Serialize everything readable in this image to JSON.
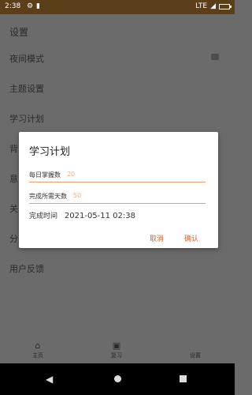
{
  "status_bar": {
    "time": "2:38",
    "network": "LTE",
    "icons": [
      "settings-icon",
      "lock-icon",
      "signal-icon",
      "battery-icon"
    ]
  },
  "app_bar": {
    "title": "设置"
  },
  "settings": {
    "items": [
      {
        "label": "夜间模式",
        "has_toggle": true
      },
      {
        "label": "主题设置"
      },
      {
        "label": "学习计划"
      },
      {
        "label": "背"
      },
      {
        "label": "意"
      },
      {
        "label": "关"
      },
      {
        "label": "分"
      },
      {
        "label": "用户反馈"
      }
    ]
  },
  "dialog": {
    "title": "学习计划",
    "daily_label": "每日掌握数",
    "daily_value": "20",
    "days_label": "完成所需天数",
    "days_value": "50",
    "finish_label": "完成时间",
    "finish_value": "2021-05-11 02:38",
    "cancel": "取消",
    "confirm": "确认"
  },
  "bottom_nav": [
    {
      "label": "主页",
      "icon": "home-icon"
    },
    {
      "label": "复习",
      "icon": "chat-icon"
    },
    {
      "label": "设置",
      "icon": "settings-icon"
    }
  ],
  "system_nav": {
    "icons": [
      "back-icon",
      "home-icon",
      "recents-icon"
    ]
  }
}
